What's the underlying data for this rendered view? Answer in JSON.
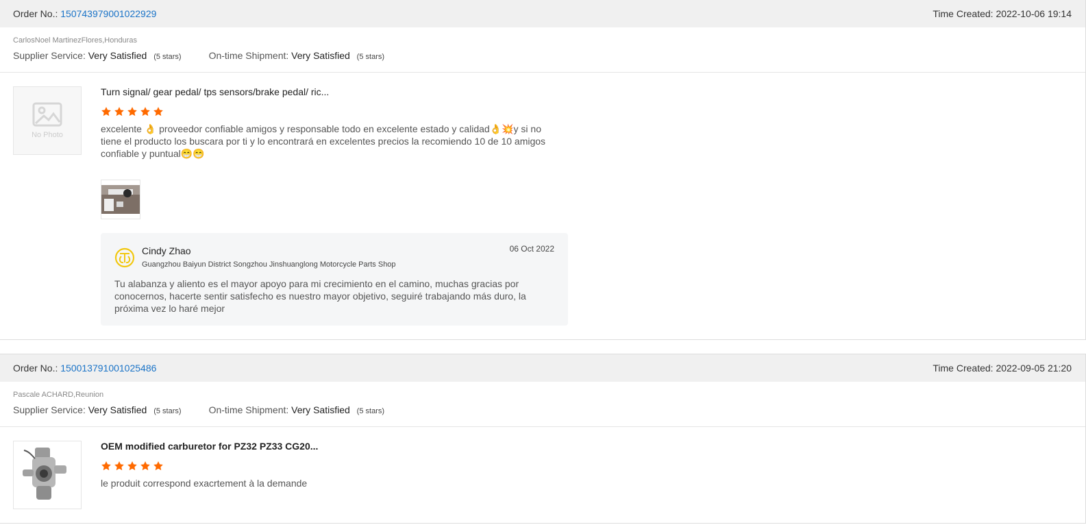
{
  "orders": [
    {
      "order_label": "Order No.:",
      "order_number": "150743979001022929",
      "time_label": "Time Created:",
      "time_value": "2022-10-06 19:14",
      "buyer": "CarlosNoel MartinezFlores,Honduras",
      "supplier_label": "Supplier Service:",
      "supplier_value": "Very Satisfied",
      "supplier_stars": "(5 stars)",
      "shipment_label": "On-time Shipment:",
      "shipment_value": "Very Satisfied",
      "shipment_stars": "(5 stars)",
      "product_title": "Turn signal/ gear pedal/ tps sensors/brake pedal/ ric...",
      "product_thumb_label": "No Photo",
      "rating": 5,
      "review_text": "excelente 👌 proveedor confiable amigos y responsable todo en excelente estado y calidad👌💥y si no tiene el producto los buscara por ti y lo encontrará en excelentes precios la recomiendo 10 de 10 amigos confiable y puntual😁😁",
      "reply": {
        "name": "Cindy Zhao",
        "shop": "Guangzhou Baiyun District Songzhou Jinshuanglong Motorcycle Parts Shop",
        "date": "06 Oct 2022",
        "text": "Tu alabanza y aliento es el mayor apoyo para mi crecimiento en el camino, muchas gracias por conocernos, hacerte sentir satisfecho es nuestro mayor objetivo, seguiré trabajando más duro, la próxima vez lo haré mejor"
      }
    },
    {
      "order_label": "Order No.:",
      "order_number": "150013791001025486",
      "time_label": "Time Created:",
      "time_value": "2022-09-05 21:20",
      "buyer": "Pascale ACHARD,Reunion",
      "supplier_label": "Supplier Service:",
      "supplier_value": "Very Satisfied",
      "supplier_stars": "(5 stars)",
      "shipment_label": "On-time Shipment:",
      "shipment_value": "Very Satisfied",
      "shipment_stars": "(5 stars)",
      "product_title": "OEM modified carburetor for PZ32 PZ33 CG20...",
      "rating": 5,
      "review_text": "le produit correspond exacrtement à la demande"
    }
  ],
  "colors": {
    "link": "#1a73c7",
    "star": "#ff6a00",
    "header_bg": "#f0f0f0",
    "reply_bg": "#f5f6f7",
    "logo": "#f2c811"
  },
  "icons": [
    "star-icon",
    "no-photo-icon",
    "shop-logo-icon",
    "review-photo",
    "carburetor-photo"
  ]
}
